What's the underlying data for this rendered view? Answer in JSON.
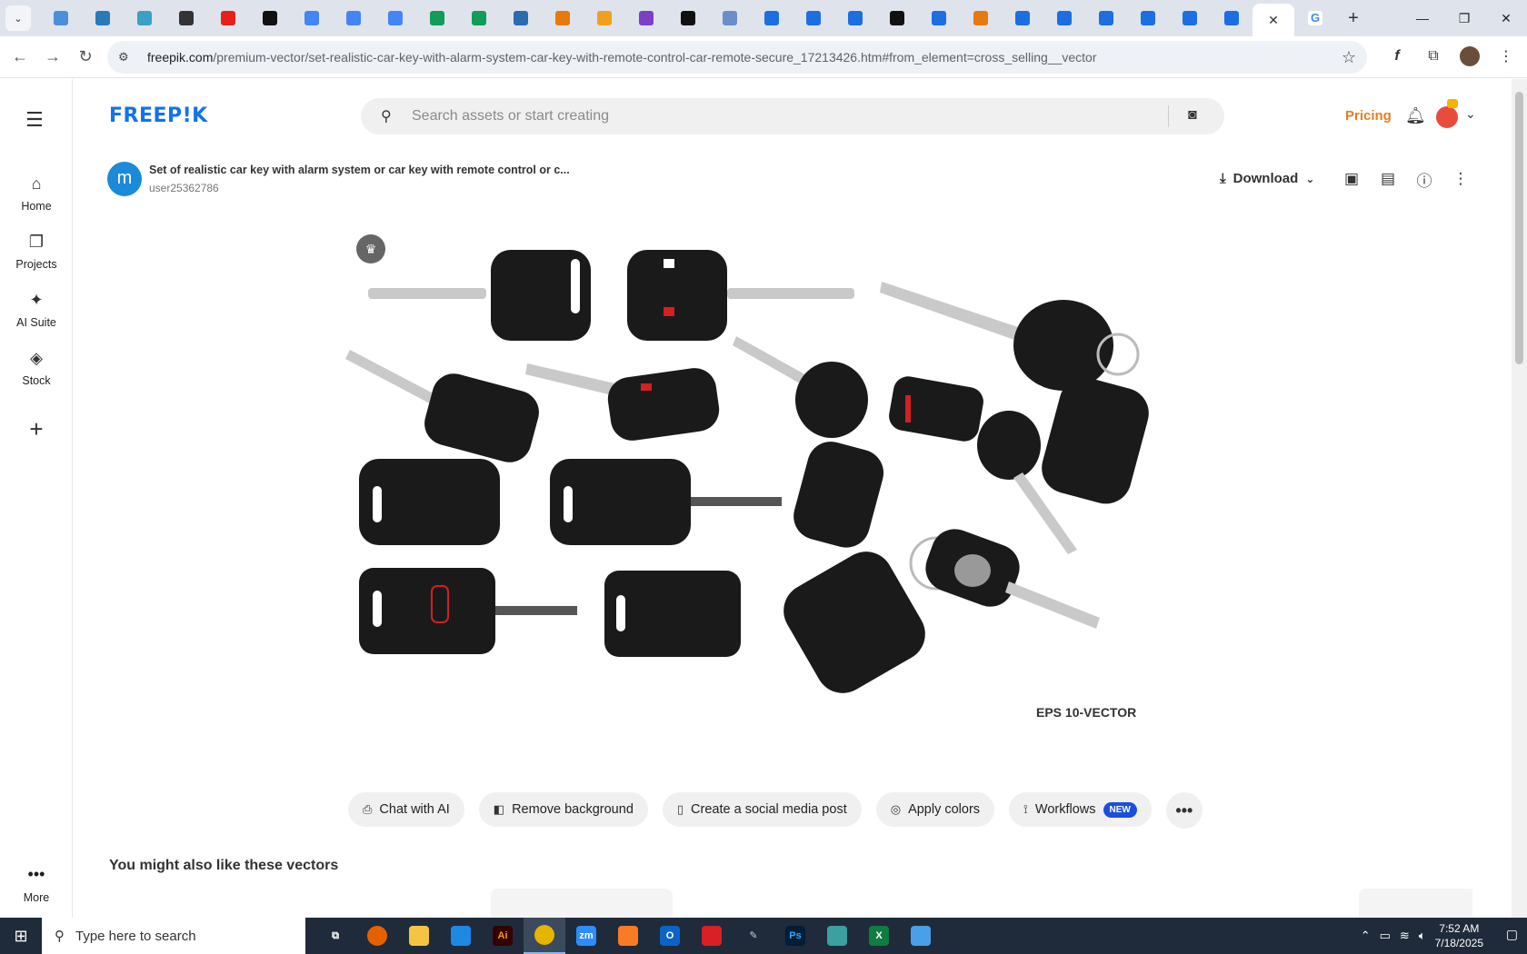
{
  "browser": {
    "tabs": [
      {
        "icon": "earth-icon",
        "color": "#4a8fd8"
      },
      {
        "icon": "v-icon",
        "color": "#2a7ab8"
      },
      {
        "icon": "arrow-icon",
        "color": "#3aa0c8"
      },
      {
        "icon": "openai-icon",
        "color": "#333333"
      },
      {
        "icon": "youtube-icon",
        "color": "#e62117"
      },
      {
        "icon": "bolt-icon",
        "color": "#111111"
      },
      {
        "icon": "doc-icon",
        "color": "#4285f4"
      },
      {
        "icon": "doc-icon",
        "color": "#4285f4"
      },
      {
        "icon": "doc-icon",
        "color": "#4285f4"
      },
      {
        "icon": "sheet-icon",
        "color": "#0f9d58"
      },
      {
        "icon": "sheet-icon",
        "color": "#0f9d58"
      },
      {
        "icon": "ms-icon",
        "color": "#2b6cb0"
      },
      {
        "icon": "box-icon",
        "color": "#e8790c"
      },
      {
        "icon": "v-icon",
        "color": "#f0a020"
      },
      {
        "icon": "brace-icon",
        "color": "#7b3fc8"
      },
      {
        "icon": "a-icon",
        "color": "#111111"
      },
      {
        "icon": "grid-icon",
        "color": "#6a8ec8"
      },
      {
        "icon": "doc-icon",
        "color": "#1b6fe0"
      },
      {
        "icon": "doc-icon",
        "color": "#1b6fe0"
      },
      {
        "icon": "doc-icon",
        "color": "#1b6fe0"
      },
      {
        "icon": "m-icon",
        "color": "#111111"
      },
      {
        "icon": "doc-icon",
        "color": "#1b6fe0"
      },
      {
        "icon": "hand-icon",
        "color": "#e8790c"
      },
      {
        "icon": "doc-icon",
        "color": "#1b6fe0"
      },
      {
        "icon": "doc-icon",
        "color": "#1b6fe0"
      },
      {
        "icon": "doc-icon",
        "color": "#1b6fe0"
      },
      {
        "icon": "doc-icon",
        "color": "#1b6fe0"
      },
      {
        "icon": "doc-icon",
        "color": "#1b6fe0"
      },
      {
        "icon": "doc-icon",
        "color": "#1b6fe0"
      }
    ],
    "url_host": "freepik.com",
    "url_path": "/premium-vector/set-realistic-car-key-with-alarm-system-car-key-with-remote-control-car-remote-secure_17213426.htm#from_element=cross_selling__vector"
  },
  "sidebar": {
    "items": [
      {
        "label": "Home"
      },
      {
        "label": "Projects"
      },
      {
        "label": "AI Suite"
      },
      {
        "label": "Stock"
      }
    ],
    "more_label": "More"
  },
  "header": {
    "logo": "FREEP!K",
    "search_placeholder": "Search assets or start creating",
    "pricing": "Pricing"
  },
  "asset": {
    "author_initial": "m",
    "title": "Set of realistic car key with alarm system or car key with remote control or c...",
    "user": "user25362786",
    "download_label": "Download",
    "eps_label": "EPS 10-VECTOR"
  },
  "actions": [
    {
      "label": "Chat with AI",
      "icon": "chat-icon"
    },
    {
      "label": "Remove background",
      "icon": "layers-icon"
    },
    {
      "label": "Create a social media post",
      "icon": "phone-icon"
    },
    {
      "label": "Apply colors",
      "icon": "palette-icon"
    },
    {
      "label": "Workflows",
      "icon": "workflow-icon",
      "badge": "NEW"
    }
  ],
  "related_heading": "You might also like these vectors",
  "taskbar": {
    "search_placeholder": "Type here to search",
    "time": "7:52 AM",
    "date": "7/18/2025"
  }
}
